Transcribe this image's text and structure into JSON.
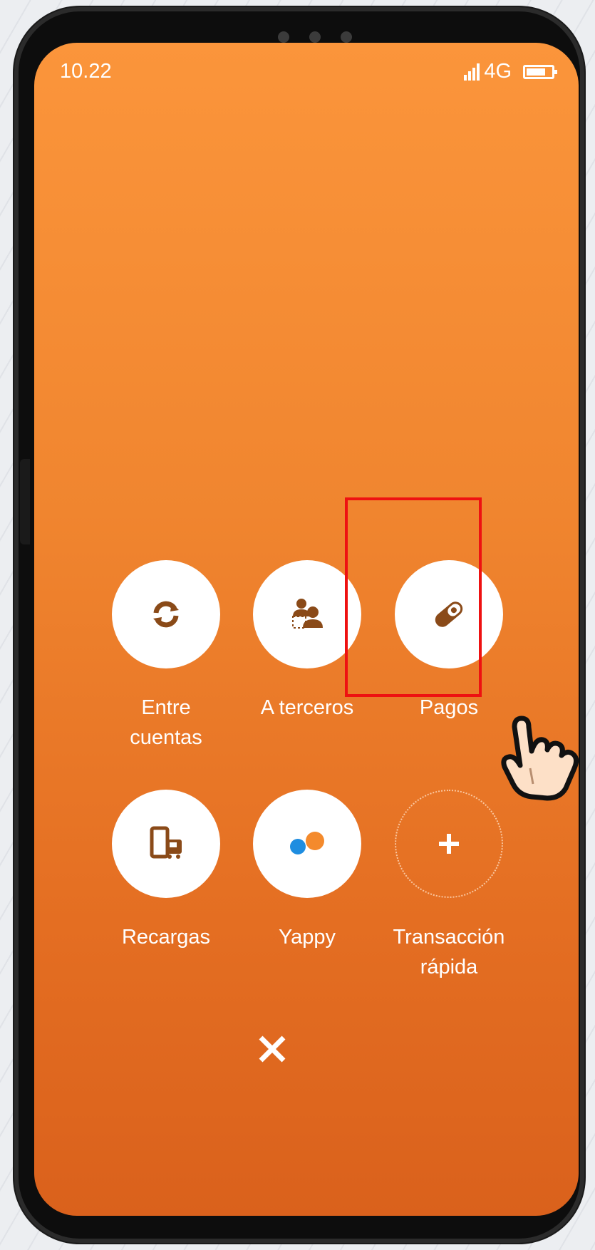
{
  "status_bar": {
    "time": "10.22",
    "network": "4G"
  },
  "menu": {
    "items": [
      {
        "label": "Entre\ncuentas",
        "icon": "transfer-cycle-icon"
      },
      {
        "label": "A terceros",
        "icon": "third-party-users-icon"
      },
      {
        "label": "Pagos",
        "icon": "payment-pill-icon"
      },
      {
        "label": "Recargas",
        "icon": "phone-recharge-icon"
      },
      {
        "label": "Yappy",
        "icon": "yappy-logo-icon"
      },
      {
        "label": "Transacción\nrápida",
        "icon": "plus-icon"
      }
    ],
    "highlighted_item": "Pagos",
    "close_icon": "close-icon"
  },
  "colors": {
    "screen_top": "#fb953b",
    "screen_bottom": "#da611c",
    "icon_brown": "#8a4a18",
    "highlight": "#ee1111",
    "yappy_blue": "#1e8de0",
    "yappy_orange": "#f48a2c"
  }
}
